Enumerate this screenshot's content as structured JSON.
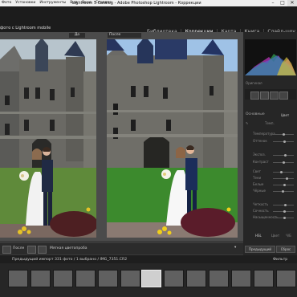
{
  "window": {
    "title": "Lightroom 5 Catalog - Adobe Photoshop Lightroom - Коррекции",
    "menu": [
      "Фото",
      "Установки",
      "Инструменты",
      "Вид",
      "Окно",
      "Справка"
    ],
    "controls": [
      "–",
      "□",
      "✕"
    ]
  },
  "identity": {
    "catalog_label": "фото с Lightroom mobile"
  },
  "modules": {
    "items": [
      "Библиотека",
      "Коррекции",
      "Карта",
      "Книга",
      "Слайд-шоу"
    ],
    "active": "Коррекции"
  },
  "view": {
    "before_label": "До",
    "after_label": "После"
  },
  "right_panel": {
    "original_photo_label": "Оригинал",
    "basic_label": "Основные",
    "treatment_label": "Цвет",
    "wb_label": "Темп.",
    "sliders": [
      "Температура",
      "Оттенок",
      "Экспоз.",
      "Контраст",
      "Свет",
      "Тени",
      "Белые",
      "Чёрные",
      "Четкость",
      "Сочность",
      "Насыщенность"
    ],
    "prev_button": "Предыдущий",
    "reset_button": "Сброс",
    "tabs": [
      "HSL",
      "Цвет",
      "Ч/Б"
    ]
  },
  "toolbar": {
    "mode_label": "После",
    "softproof_label": "Мягкая цветопроба"
  },
  "filmstrip": {
    "source_label": "Предыдущий импорт",
    "count_label": "331 фото / 1 выбрано /",
    "file_label": "IMG_7351.CR2",
    "filter_label": "Фильтр"
  },
  "colors": {
    "accent": "#e0e0e0",
    "panel_bg": "#262626",
    "view_bg": "#4b4b4b"
  }
}
